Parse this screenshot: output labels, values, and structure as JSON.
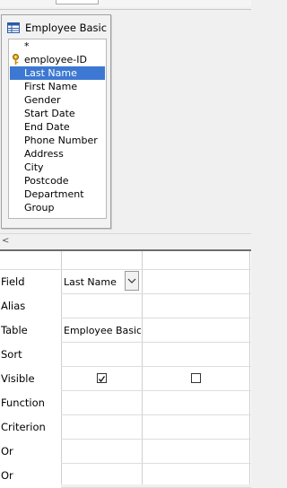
{
  "table_window": {
    "title": "Employee Basic D",
    "icon": "table-icon",
    "fields": [
      {
        "label": "*",
        "key": false,
        "selected": false
      },
      {
        "label": "employee-ID",
        "key": true,
        "selected": false
      },
      {
        "label": "Last Name",
        "key": false,
        "selected": true
      },
      {
        "label": "First Name",
        "key": false,
        "selected": false
      },
      {
        "label": "Gender",
        "key": false,
        "selected": false
      },
      {
        "label": "Start Date",
        "key": false,
        "selected": false
      },
      {
        "label": "End Date",
        "key": false,
        "selected": false
      },
      {
        "label": "Phone Number",
        "key": false,
        "selected": false
      },
      {
        "label": "Address",
        "key": false,
        "selected": false
      },
      {
        "label": "City",
        "key": false,
        "selected": false
      },
      {
        "label": "Postcode",
        "key": false,
        "selected": false
      },
      {
        "label": "Department",
        "key": false,
        "selected": false
      },
      {
        "label": "Group",
        "key": false,
        "selected": false
      }
    ]
  },
  "scroll_left_glyph": "<",
  "grid": {
    "rows": [
      "Field",
      "Alias",
      "Table",
      "Sort",
      "Visible",
      "Function",
      "Criterion",
      "Or",
      "Or"
    ],
    "columns": [
      {
        "field": "Last Name",
        "table": "Employee Basic I",
        "visible": true
      },
      {
        "field": "",
        "table": "",
        "visible": false
      }
    ]
  }
}
